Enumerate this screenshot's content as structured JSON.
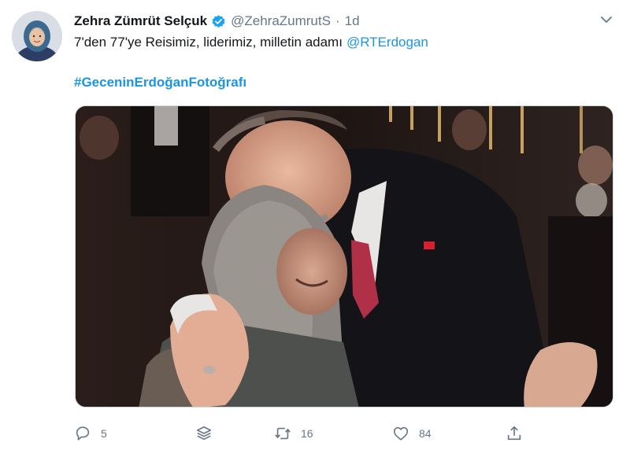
{
  "user": {
    "name": "Zehra Zümrüt Selçuk",
    "handle": "@ZehraZumrutS",
    "separator": "·",
    "time": "1d"
  },
  "tweet": {
    "text": "7'den 77'ye Reisimiz, liderimiz, milletin adamı",
    "mention": "@RTErdogan",
    "hashtag": "#GeceninErdoğanFotoğrafı"
  },
  "actions": {
    "replies": "5",
    "retweets": "16",
    "likes": "84"
  },
  "icons": {
    "verified": "verified-badge-icon",
    "caret": "chevron-down-icon",
    "reply": "reply-icon",
    "stack": "layers-icon",
    "retweet": "retweet-icon",
    "like": "heart-icon",
    "share": "share-icon"
  },
  "colors": {
    "link": "#1b95e0",
    "secondary_text": "#657786",
    "primary_text": "#14171a",
    "verified_badge": "#1da1f2"
  }
}
